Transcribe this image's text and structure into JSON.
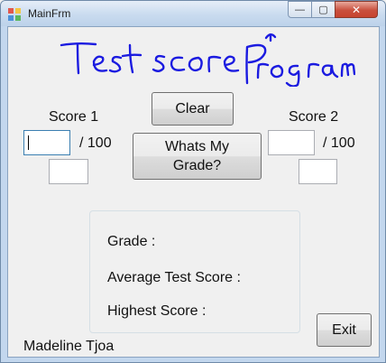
{
  "window": {
    "title": "MainFrm"
  },
  "caption_buttons": {
    "minimize": "—",
    "maximize": "▢",
    "close": "✕"
  },
  "banner": {
    "handwritten_text": "Test score Program"
  },
  "score1": {
    "label": "Score 1",
    "value": "",
    "out_of": "/ 100",
    "secondary_value": ""
  },
  "score2": {
    "label": "Score 2",
    "value": "",
    "out_of": "/ 100",
    "secondary_value": ""
  },
  "buttons": {
    "clear": "Clear",
    "grade_line1": "Whats My",
    "grade_line2": "Grade?",
    "exit": "Exit"
  },
  "results": {
    "grade_label": "Grade :",
    "average_label": "Average Test Score :",
    "highest_label": "Highest Score :"
  },
  "footer": {
    "author": "Madeline Tjoa"
  }
}
